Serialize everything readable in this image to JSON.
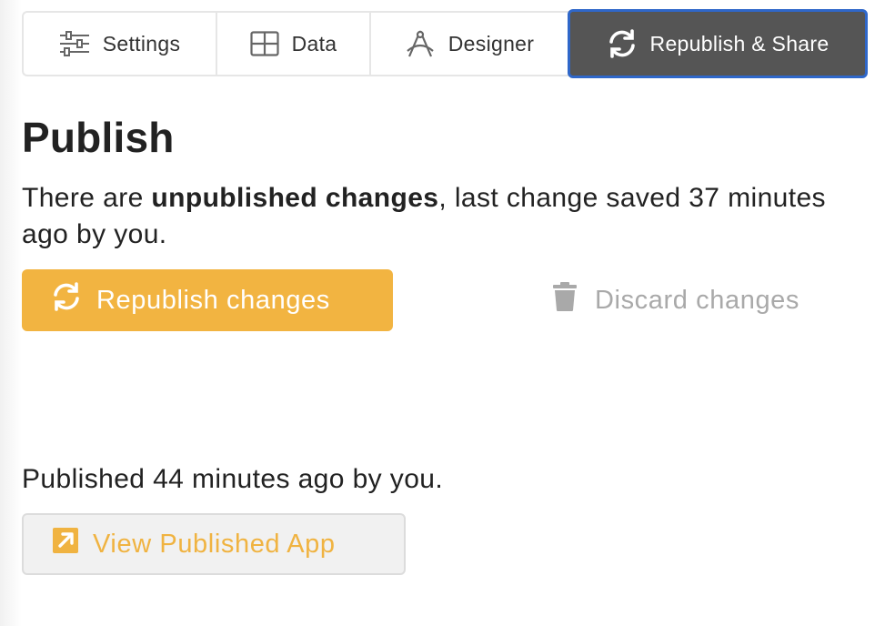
{
  "colors": {
    "accent": "#f2b441",
    "active_tab_bg": "#555555",
    "active_tab_border": "#2f67c9",
    "muted": "#a9a9a9"
  },
  "tabs": [
    {
      "label": "Settings",
      "icon": "sliders-icon",
      "active": false
    },
    {
      "label": "Data",
      "icon": "grid-icon",
      "active": false
    },
    {
      "label": "Designer",
      "icon": "compass-icon",
      "active": false
    },
    {
      "label": "Republish & Share",
      "icon": "refresh-icon",
      "active": true
    }
  ],
  "publish": {
    "title": "Publish",
    "status_prefix": "There are ",
    "status_bold": "unpublished changes",
    "status_suffix": ", last change saved 37 minutes ago by you.",
    "republish_label": "Republish changes",
    "republish_icon": "refresh-icon",
    "discard_label": "Discard changes",
    "discard_icon": "trash-icon",
    "published_text": "Published 44 minutes ago by you.",
    "view_label": "View Published App",
    "view_icon": "external-link-icon"
  }
}
